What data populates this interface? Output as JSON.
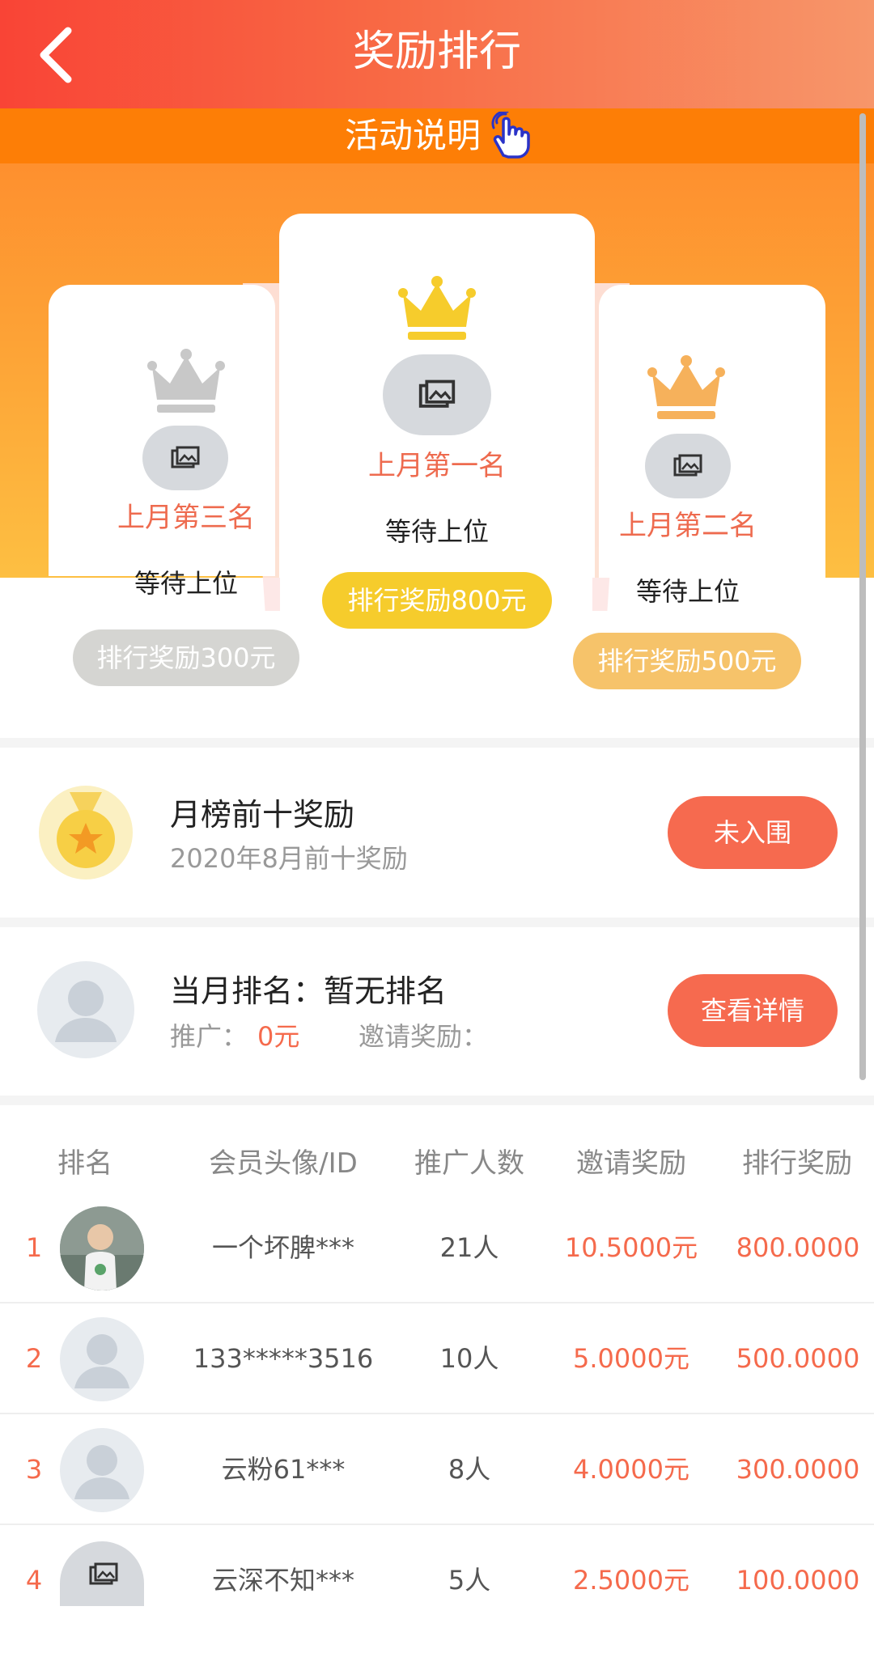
{
  "header": {
    "title": "奖励排行"
  },
  "activity": {
    "label": "活动说明"
  },
  "podium": {
    "first": {
      "rank_label": "上月第一名",
      "status": "等待上位",
      "prize": "排行奖励800元"
    },
    "second": {
      "rank_label": "上月第二名",
      "status": "等待上位",
      "prize": "排行奖励500元"
    },
    "third": {
      "rank_label": "上月第三名",
      "status": "等待上位",
      "prize": "排行奖励300元"
    }
  },
  "monthly_top10": {
    "title": "月榜前十奖励",
    "subtitle": "2020年8月前十奖励",
    "button": "未入围"
  },
  "my_rank": {
    "title": "当月排名：暂无排名",
    "promo_label": "推广：",
    "promo_value": "0元",
    "invite_label": "邀请奖励："
  },
  "my_rank_button": "查看详情",
  "table": {
    "headers": [
      "排名",
      "会员头像/ID",
      "推广人数",
      "邀请奖励",
      "排行奖励"
    ],
    "rows": [
      {
        "rank": "1",
        "name": "一个坏脾***",
        "count": "21人",
        "invite": "10.5000元",
        "reward": "800.0000"
      },
      {
        "rank": "2",
        "name": "133*****3516",
        "count": "10人",
        "invite": "5.0000元",
        "reward": "500.0000"
      },
      {
        "rank": "3",
        "name": "云粉61***",
        "count": "8人",
        "invite": "4.0000元",
        "reward": "300.0000"
      },
      {
        "rank": "4",
        "name": "云深不知***",
        "count": "5人",
        "invite": "2.5000元",
        "reward": "100.0000"
      }
    ]
  },
  "colors": {
    "accent": "#f66a4f",
    "gold": "#f6cc2c",
    "silver": "#d5d5d2",
    "bronze": "#f6c36a"
  }
}
